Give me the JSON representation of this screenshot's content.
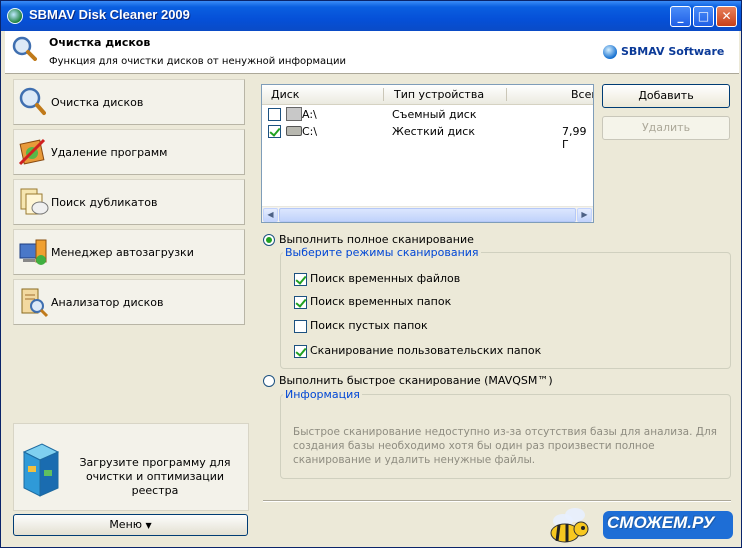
{
  "window": {
    "title": "SBMAV Disk Cleaner 2009",
    "controls": {
      "minimize": "_",
      "maximize": "□",
      "close": "✕"
    }
  },
  "header": {
    "title": "Очистка дисков",
    "subtitle": "Функция для очистки дисков от ненужной информации",
    "brand": "SBMAV Software"
  },
  "sidebar": {
    "items": [
      {
        "label": "Очистка дисков",
        "icon": "magnifier-disk-icon"
      },
      {
        "label": "Удаление программ",
        "icon": "uninstall-box-icon"
      },
      {
        "label": "Поиск дубликатов",
        "icon": "duplicate-docs-icon"
      },
      {
        "label": "Менеджер автозагрузки",
        "icon": "startup-manager-icon"
      },
      {
        "label": "Анализатор дисков",
        "icon": "disk-analyzer-icon"
      }
    ],
    "promo": "Загрузите программу для очистки и оптимизации реестра",
    "menu_button": "Меню"
  },
  "disk_list": {
    "columns": [
      "Диск",
      "Тип устройства",
      "Всег"
    ],
    "rows": [
      {
        "checked": false,
        "drive": "A:\\",
        "type": "Съемный диск",
        "total": ""
      },
      {
        "checked": true,
        "drive": "C:\\",
        "type": "Жесткий диск",
        "total": "7,99 Г"
      }
    ]
  },
  "buttons": {
    "add": "Добавить",
    "remove": "Удалить"
  },
  "scan": {
    "full_label": "Выполнить полное сканирование",
    "full_selected": true,
    "modes_title": "Выберите режимы сканирования",
    "options": [
      {
        "label": "Поиск временных файлов",
        "checked": true
      },
      {
        "label": "Поиск временных папок",
        "checked": true
      },
      {
        "label": "Поиск пустых папок",
        "checked": false
      },
      {
        "label": "Сканирование пользовательских папок",
        "checked": true
      }
    ],
    "quick_label": "Выполнить быстрое сканирование (MAVQSM™)",
    "quick_selected": false,
    "info_title": "Информация",
    "info_text": "Быстрое сканирование недоступно из-за отсутствия базы для анализа. Для создания базы необходимо хотя бы один раз произвести полное сканирование и удалить ненужные файлы."
  },
  "watermark": "СМОЖЕМ.РУ",
  "colors": {
    "titlebar": "#0550d8",
    "window_bg": "#ece9d8",
    "accent_text": "#0046d5",
    "check_green": "#21a121"
  }
}
